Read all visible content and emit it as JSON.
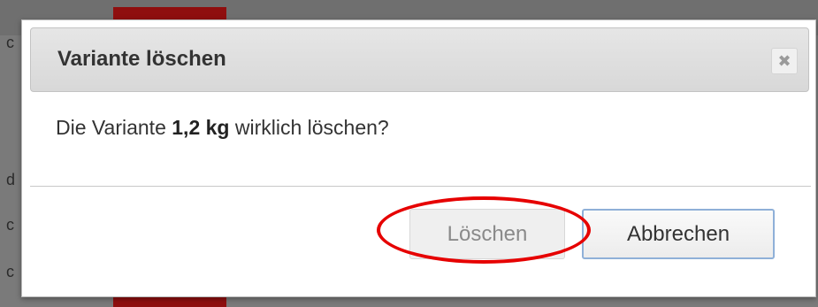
{
  "background": {
    "letters": [
      "c",
      "d",
      "c",
      "c"
    ]
  },
  "dialog": {
    "title": "Variante löschen",
    "close_symbol": "✖",
    "close_icon": "close-icon",
    "message_prefix": "Die Variante ",
    "message_bold": "1,2 kg",
    "message_suffix": " wirklich löschen?",
    "buttons": {
      "delete_label": "Löschen",
      "cancel_label": "Abbrechen"
    }
  },
  "colors": {
    "highlight": "#e60000",
    "cancel_border": "#8fb0d8",
    "titlebar": "#dcdcdc"
  }
}
